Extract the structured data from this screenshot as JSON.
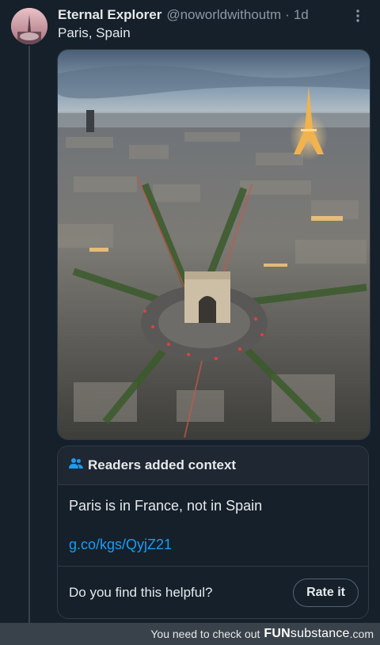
{
  "tweet": {
    "display_name": "Eternal Explorer",
    "handle": "@noworldwithoutm",
    "separator": "·",
    "time": "1d",
    "more_icon": "more-dots-icon",
    "text": "Paris, Spain"
  },
  "media": {
    "subject": "aerial-photo-arc-de-triomphe-eiffel-tower"
  },
  "community_note": {
    "icon": "people-icon",
    "title": "Readers added context",
    "note": "Paris is in France, not in Spain",
    "link": "g.co/kgs/QyjZ21",
    "helpful_question": "Do you find this helpful?",
    "rate_button": "Rate it"
  },
  "watermark": {
    "prefix": "You need to check out",
    "brand_bold": "FUN",
    "brand_rest": "substance",
    "tld": ".com"
  },
  "colors": {
    "background": "#15202b",
    "link": "#1d9bf0",
    "muted": "#8b98a5"
  }
}
